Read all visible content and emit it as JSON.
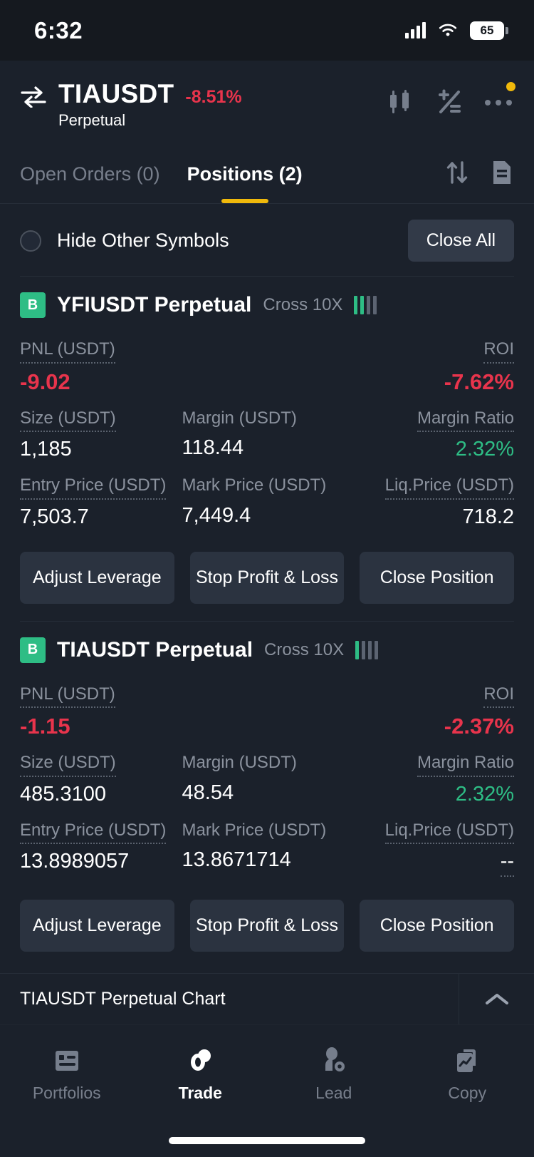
{
  "status_bar": {
    "time": "6:32",
    "battery": "65",
    "signal_icon": "cellular-signal-icon",
    "wifi_icon": "wifi-icon",
    "battery_icon": "battery-icon"
  },
  "header": {
    "swap_icon": "swap-arrows-icon",
    "symbol": "TIAUSDT",
    "change_pct": "-8.51%",
    "subtitle": "Perpetual",
    "change_color": "#e8344c",
    "icons": [
      {
        "name": "candlestick-chart-icon"
      },
      {
        "name": "calculator-icon"
      },
      {
        "name": "more-options-icon",
        "badge": true
      }
    ],
    "badge_color": "#f0b90b"
  },
  "tabs": {
    "items": [
      {
        "label": "Open Orders (0)",
        "active": false
      },
      {
        "label": "Positions (2)",
        "active": true
      }
    ],
    "active_underline_color": "#f0b90b",
    "icons": [
      {
        "name": "sort-arrows-icon"
      },
      {
        "name": "order-history-document-icon"
      }
    ]
  },
  "filter_bar": {
    "hide_other_symbols_label": "Hide Other Symbols",
    "radio_icon": "radio-unchecked-icon",
    "close_all_label": "Close All"
  },
  "positions": [
    {
      "badge": "B",
      "badge_color": "#2ebd85",
      "title": "YFIUSDT Perpetual",
      "mode": "Cross 10X",
      "risk_icon": "risk-level-bars-icon",
      "risk_bars_on": 2,
      "risk_bars_total": 4,
      "pnl_label": "PNL (USDT)",
      "pnl_value": "-9.02",
      "roi_label": "ROI",
      "roi_value": "-7.62%",
      "size_label": "Size (USDT)",
      "size_value": "1,185",
      "margin_label": "Margin (USDT)",
      "margin_value": "118.44",
      "margin_ratio_label": "Margin Ratio",
      "margin_ratio_value": "2.32%",
      "entry_label": "Entry Price (USDT)",
      "entry_value": "7,503.7",
      "mark_label": "Mark Price (USDT)",
      "mark_value": "7,449.4",
      "liq_label": "Liq.Price (USDT)",
      "liq_value": "718.2",
      "liq_dotted": false,
      "buttons": {
        "adjust_leverage": "Adjust Leverage",
        "stop_profit_loss": "Stop Profit & Loss",
        "close_position": "Close Position"
      }
    },
    {
      "badge": "B",
      "badge_color": "#2ebd85",
      "title": "TIAUSDT Perpetual",
      "mode": "Cross 10X",
      "risk_icon": "risk-level-bars-icon",
      "risk_bars_on": 1,
      "risk_bars_total": 4,
      "pnl_label": "PNL (USDT)",
      "pnl_value": "-1.15",
      "roi_label": "ROI",
      "roi_value": "-2.37%",
      "size_label": "Size (USDT)",
      "size_value": "485.3100",
      "margin_label": "Margin (USDT)",
      "margin_value": "48.54",
      "margin_ratio_label": "Margin Ratio",
      "margin_ratio_value": "2.32%",
      "entry_label": "Entry Price (USDT)",
      "entry_value": "13.8989057",
      "mark_label": "Mark Price (USDT)",
      "mark_value": "13.8671714",
      "liq_label": "Liq.Price (USDT)",
      "liq_value": "--",
      "liq_dotted": true,
      "buttons": {
        "adjust_leverage": "Adjust Leverage",
        "stop_profit_loss": "Stop Profit & Loss",
        "close_position": "Close Position"
      }
    }
  ],
  "chart_strip": {
    "label": "TIAUSDT Perpetual  Chart",
    "toggle_icon": "chevron-up-icon"
  },
  "bottom_nav": {
    "items": [
      {
        "label": "Portfolios",
        "icon": "portfolios-icon",
        "active": false
      },
      {
        "label": "Trade",
        "icon": "trade-icon",
        "active": true
      },
      {
        "label": "Lead",
        "icon": "lead-person-icon",
        "active": false
      },
      {
        "label": "Copy",
        "icon": "copy-chart-icon",
        "active": false
      }
    ]
  },
  "colors": {
    "background": "#1b212b",
    "status_bar_bg": "#15191f",
    "negative": "#e8344c",
    "positive": "#2ebd85",
    "accent": "#f0b90b",
    "muted_text": "#8b929e"
  }
}
